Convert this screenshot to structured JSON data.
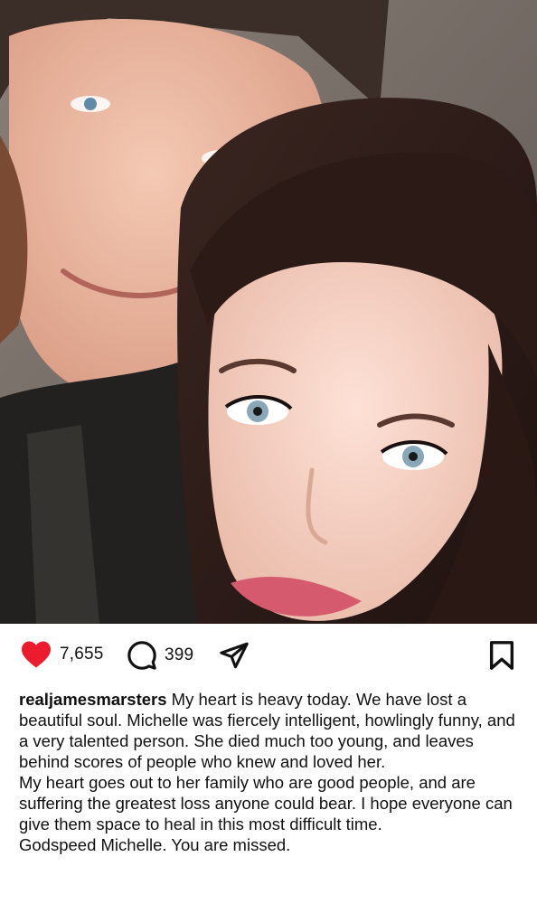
{
  "post": {
    "photo": {
      "description_icon": "photo-icon"
    },
    "actions": {
      "like_icon": "heart-filled-icon",
      "like_color": "#ed1b2e",
      "likes": "7,655",
      "comment_icon": "comment-icon",
      "comments": "399",
      "share_icon": "send-icon",
      "save_icon": "bookmark-icon"
    },
    "caption": {
      "username": "realjamesmarsters",
      "paragraphs": [
        " My heart is heavy today. We have lost a beautiful soul. Michelle was fiercely intelligent, howlingly funny, and a very talented person. She died much too young, and leaves behind scores of people who knew and loved her.",
        "My heart goes out to her family who are good people, and are suffering the greatest loss anyone could bear. I hope everyone can give them space to heal in this most difficult time.",
        "Godspeed Michelle. You are missed."
      ]
    }
  }
}
